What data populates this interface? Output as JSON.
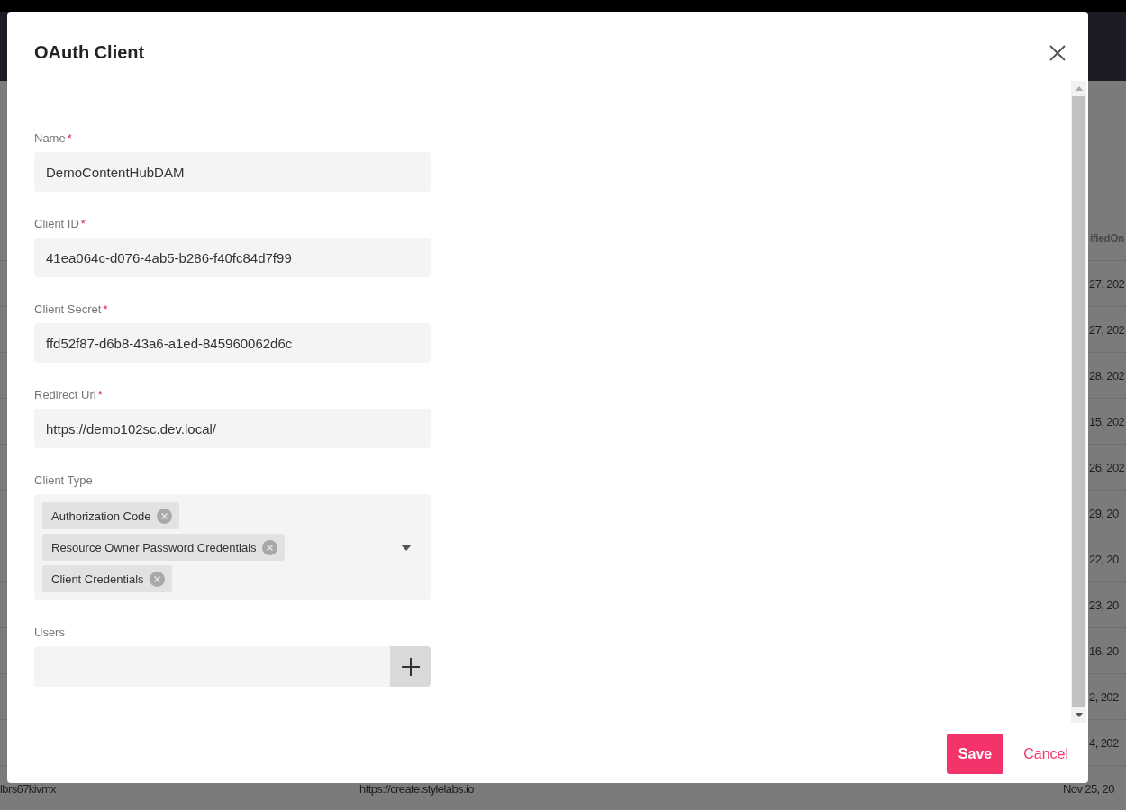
{
  "background": {
    "column_header": "ifiedOn",
    "rows": [
      {
        "kind": "partial",
        "date": "27, 202"
      },
      {
        "kind": "partial",
        "date": "27, 202"
      },
      {
        "kind": "partial",
        "date": "28, 202"
      },
      {
        "kind": "partial",
        "date": "15, 202"
      },
      {
        "kind": "partial",
        "date": "26, 202"
      },
      {
        "kind": "partial",
        "date": "29, 20"
      },
      {
        "kind": "partial",
        "date": "22, 20"
      },
      {
        "kind": "partial",
        "date": "23, 20"
      },
      {
        "kind": "partial",
        "date": "16, 20"
      },
      {
        "kind": "partial",
        "date": "2, 202"
      },
      {
        "kind": "partial",
        "date": "4, 202"
      },
      {
        "kind": "full",
        "name": "lbrs67kivmx",
        "url": "https://create.stylelabs.io",
        "date": "Nov 25, 20"
      }
    ]
  },
  "dialog": {
    "title": "OAuth Client",
    "fields": [
      {
        "kind": "text",
        "label": "Name",
        "marker": "*",
        "value": "DemoContentHubDAM"
      },
      {
        "kind": "text",
        "label": "Client ID",
        "marker": "*",
        "value": "41ea064c-d076-4ab5-b286-f40fc84d7f99"
      },
      {
        "kind": "text",
        "label": "Client Secret",
        "marker": "*",
        "value": "ffd52f87-d6b8-43a6-a1ed-845960062d6c"
      },
      {
        "kind": "text",
        "label": "Redirect Url",
        "marker": "*",
        "value": "https://demo102sc.dev.local/"
      },
      {
        "kind": "multiselect",
        "label": "Client Type",
        "chips": [
          "Authorization Code",
          "Resource Owner Password Credentials",
          "Client Credentials"
        ]
      },
      {
        "kind": "picker",
        "label": "Users"
      }
    ],
    "buttons": [
      {
        "kind": "primary",
        "label": "Save"
      },
      {
        "kind": "link",
        "label": "Cancel"
      }
    ]
  }
}
